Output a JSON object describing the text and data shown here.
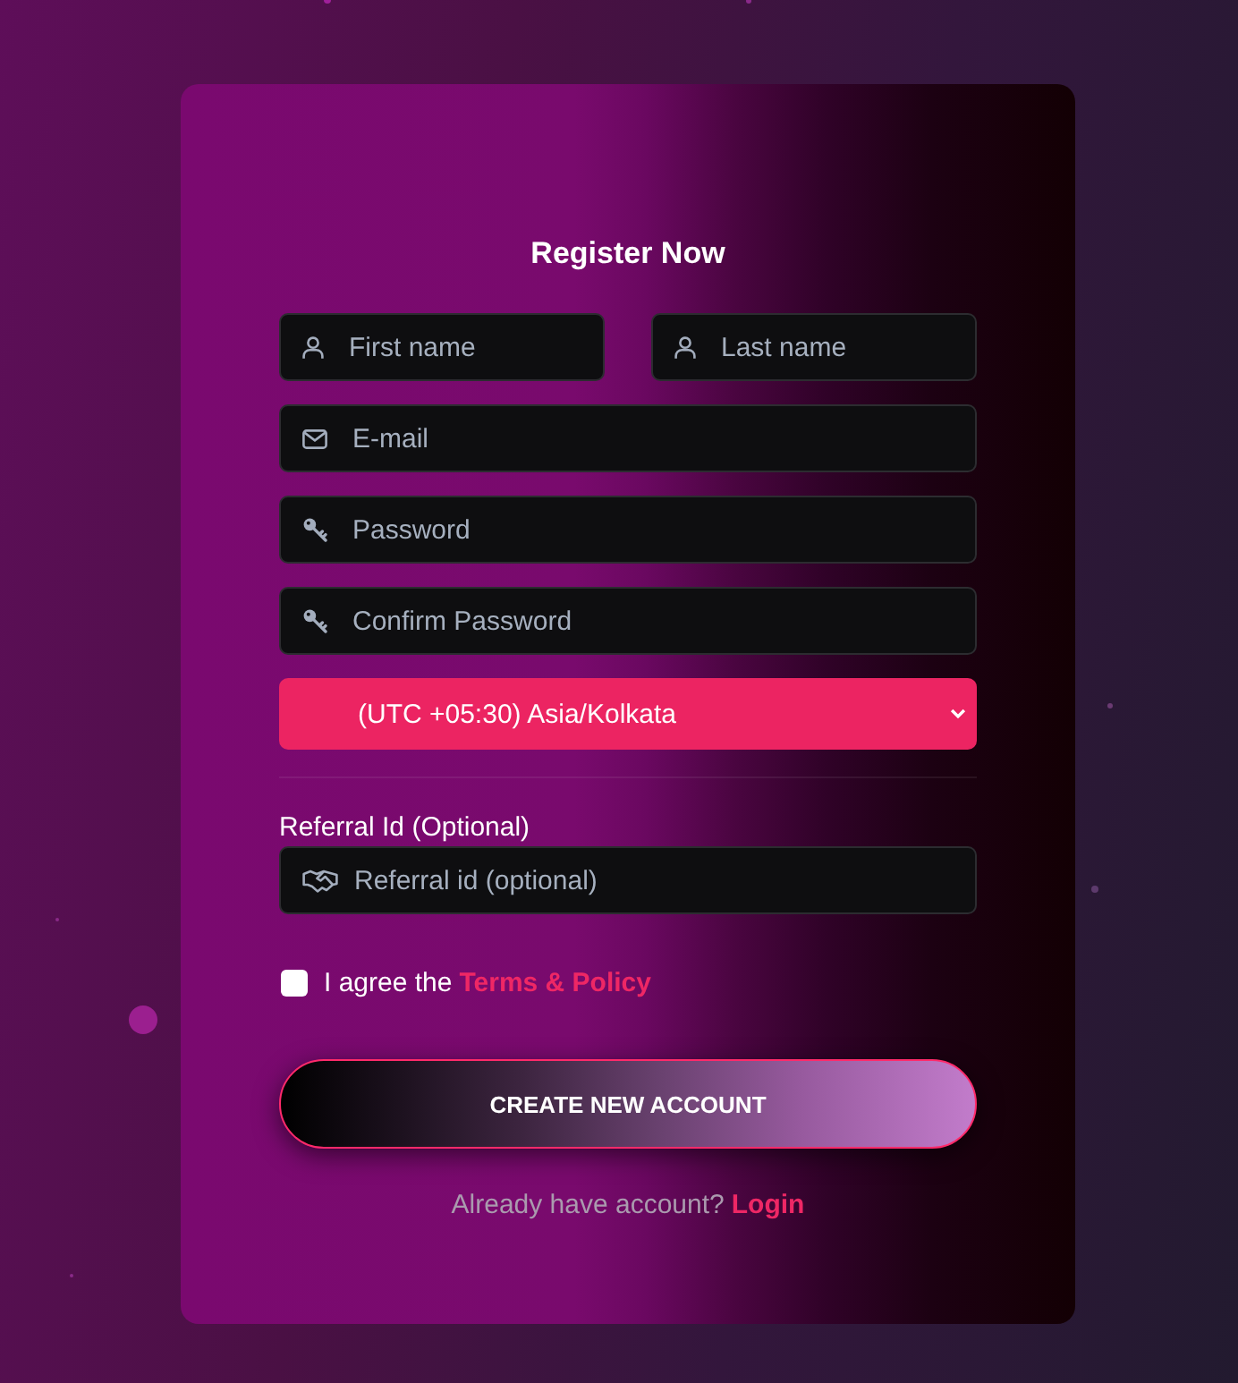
{
  "title": "Register Now",
  "field_rows": [
    [
      {
        "kind": "name",
        "placeholder": "First name"
      },
      {
        "kind": "name",
        "placeholder": "Last name"
      }
    ],
    [
      {
        "kind": "email",
        "placeholder": "E-mail"
      }
    ],
    [
      {
        "kind": "password",
        "placeholder": "Password"
      }
    ],
    [
      {
        "kind": "password",
        "placeholder": "Confirm Password"
      }
    ]
  ],
  "timezone_select": {
    "value": "(UTC +05:30) Asia/Kolkata"
  },
  "referral": {
    "label": "Referral Id (Optional)",
    "kind": "referral",
    "placeholder": "Referral id (optional)"
  },
  "agreement": {
    "checked": false,
    "text": "I agree the",
    "link": "Terms & Policy"
  },
  "submit_button": {
    "label": "CREATE NEW ACCOUNT"
  },
  "login_prompt": {
    "text": "Already have account?",
    "link": "Login"
  }
}
